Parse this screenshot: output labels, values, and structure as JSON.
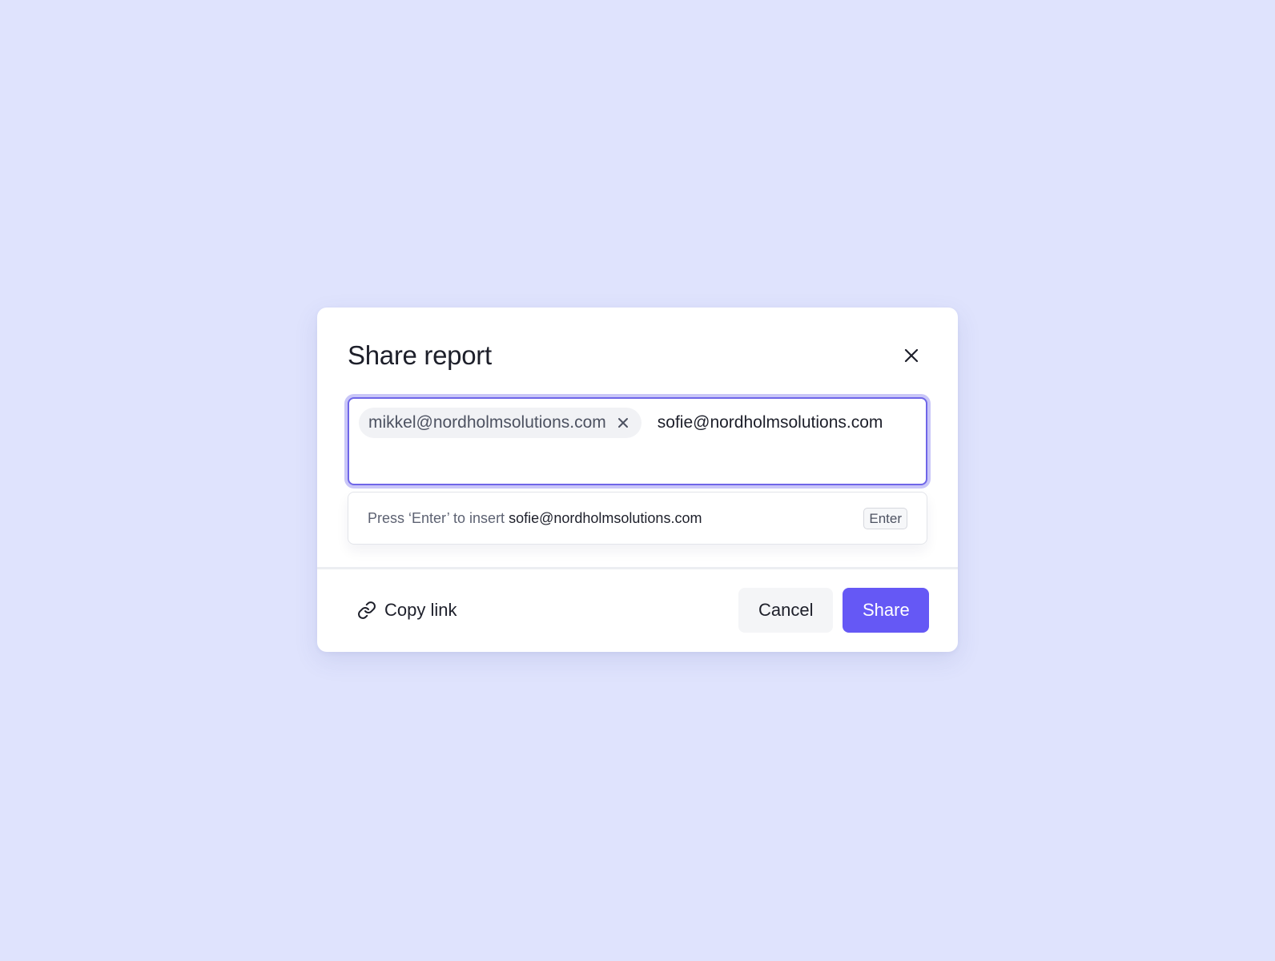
{
  "modal": {
    "title": "Share report",
    "close_icon": "close-icon"
  },
  "recipients": {
    "chips": [
      {
        "email": "mikkel@nordholmsolutions.com",
        "remove_icon": "close-icon"
      }
    ],
    "input_value": "sofie@nordholmsolutions.com"
  },
  "suggestion": {
    "prefix": "Press ‘Enter’ to insert ",
    "email": "sofie@nordholmsolutions.com",
    "key_hint": "Enter"
  },
  "footer": {
    "copy_link_icon": "link-icon",
    "copy_link_label": "Copy link",
    "cancel_label": "Cancel",
    "share_label": "Share"
  },
  "colors": {
    "page_background": "#dfe3fd",
    "accent": "#6558f5",
    "focus_border": "#6f66e8"
  }
}
